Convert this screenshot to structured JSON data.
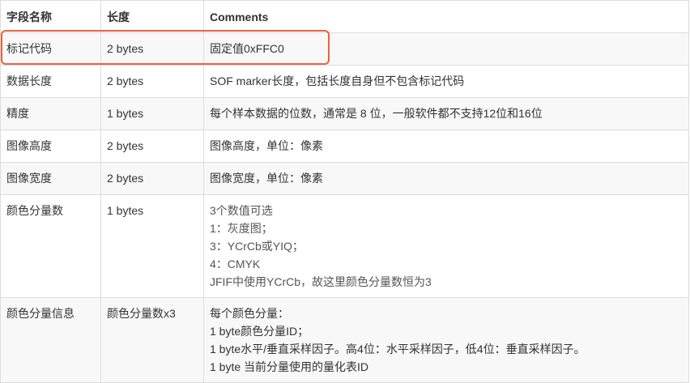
{
  "table": {
    "headers": [
      "字段名称",
      "长度",
      "Comments"
    ],
    "rows": [
      {
        "name": "标记代码",
        "length": "2 bytes",
        "comments": [
          "固定值0xFFC0"
        ]
      },
      {
        "name": "数据长度",
        "length": "2 bytes",
        "comments": [
          "SOF marker长度，包括长度自身但不包含标记代码"
        ]
      },
      {
        "name": "精度",
        "length": "1 bytes",
        "comments": [
          "每个样本数据的位数，通常是 8 位，一般软件都不支持12位和16位"
        ]
      },
      {
        "name": "图像高度",
        "length": "2 bytes",
        "comments": [
          "图像高度，单位：像素"
        ]
      },
      {
        "name": "图像宽度",
        "length": "2 bytes",
        "comments": [
          "图像宽度，单位：像素"
        ]
      },
      {
        "name": "颜色分量数",
        "length": "1 bytes",
        "comments": [
          "3个数值可选",
          "1：灰度图；",
          "3：YCrCb或YIQ；",
          "4：CMYK",
          "JFIF中使用YCrCb，故这里颜色分量数恒为3"
        ]
      },
      {
        "name": "颜色分量信息",
        "length": "颜色分量数x3",
        "comments": [
          "每个颜色分量：",
          "1 byte颜色分量ID；",
          "1 byte水平/垂直采样因子。高4位：水平采样因子，低4位：垂直采样因子。",
          "1 byte 当前分量使用的量化表ID"
        ]
      }
    ]
  },
  "highlight_color": "#e8643c"
}
